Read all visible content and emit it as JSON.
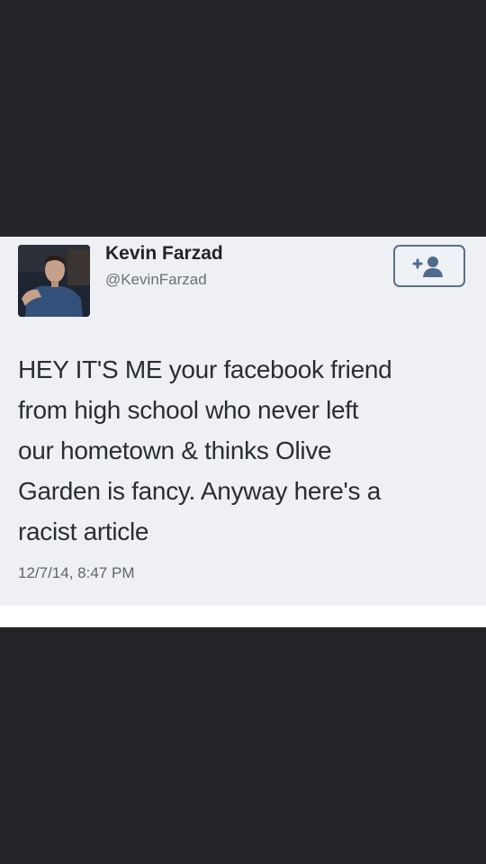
{
  "tweet": {
    "author_name": "Kevin Farzad",
    "author_handle": "@KevinFarzad",
    "text_lines": [
      "HEY IT'S ME your facebook friend",
      "from high school who never left",
      "our hometown & thinks Olive",
      "Garden is fancy. Anyway here's a",
      "racist article"
    ],
    "timestamp": "12/7/14, 8:47 PM",
    "follow_icon": "add-user-icon",
    "colors": {
      "card_background": "#eef0f3",
      "surround": "#242528",
      "follow_border": "#5b6f87",
      "name_text": "#222428",
      "muted_text": "#6b7079"
    }
  }
}
